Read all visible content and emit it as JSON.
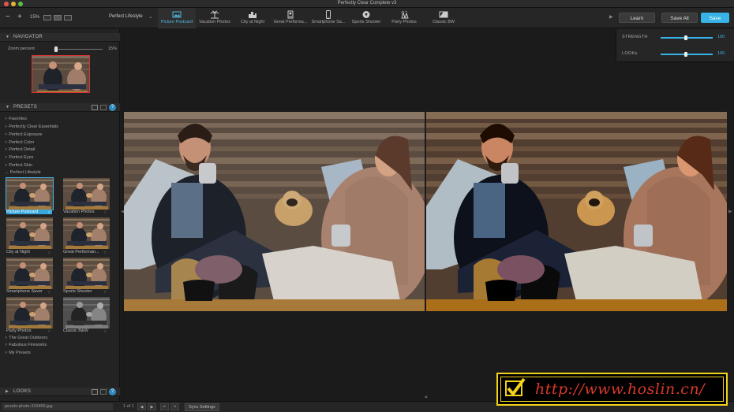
{
  "window": {
    "title": "Perfectly Clear Complete v3"
  },
  "toolbar": {
    "zoom_out": "−",
    "zoom_in": "+",
    "zoom_percent": "15%",
    "preset_selector": "Perfect Lifestyle",
    "preset_tabs": [
      {
        "label": "Picture Postcard",
        "icon": "postcard-icon",
        "active": true
      },
      {
        "label": "Vacation Photos",
        "icon": "palm-tree-icon",
        "active": false
      },
      {
        "label": "City at Night",
        "icon": "city-icon",
        "active": false
      },
      {
        "label": "Great Performa...",
        "icon": "performance-icon",
        "active": false
      },
      {
        "label": "Smartphone Sa...",
        "icon": "smartphone-icon",
        "active": false
      },
      {
        "label": "Sports Shooter",
        "icon": "soccer-ball-icon",
        "active": false
      },
      {
        "label": "Party Photos",
        "icon": "party-icon",
        "active": false
      },
      {
        "label": "Classic BW",
        "icon": "classic-bw-icon",
        "active": false
      }
    ],
    "learn_label": "Learn",
    "save_all_label": "Save All",
    "save_label": "Save"
  },
  "navigator": {
    "title": "NAVIGATOR",
    "zoom_label": "Zoom percent",
    "zoom_value": 0.03,
    "zoom_value_label": "15%"
  },
  "presets": {
    "title": "PRESETS",
    "categories_before": [
      "Favorites",
      "Perfectly Clear Essentials",
      "Perfect Exposure",
      "Perfect Color",
      "Perfect Detail",
      "Perfect Eyes",
      "Perfect Skin",
      "Perfect Lifestyle"
    ],
    "thumbnails": [
      {
        "label": "Picture Postcard",
        "selected": true
      },
      {
        "label": "Vacation Photos",
        "selected": false
      },
      {
        "label": "City at Night",
        "selected": false
      },
      {
        "label": "Great Performan...",
        "selected": false
      },
      {
        "label": "Smartphone Saver",
        "selected": false
      },
      {
        "label": "Sports Shooter",
        "selected": false
      },
      {
        "label": "Party Photos",
        "selected": false
      },
      {
        "label": "Classic B&W",
        "selected": false
      }
    ],
    "categories_after": [
      "The Great Outdoors",
      "Fabulous Fireworks",
      "My Presets"
    ]
  },
  "looks": {
    "title": "LOOKS"
  },
  "adjustments": {
    "strength_label": "STRENGTH",
    "strength_value": "100",
    "strength_level": 0.5,
    "looks_label": "LOOKs",
    "looks_value": "100",
    "looks_level": 0.5
  },
  "statusbar": {
    "filename": "pexels-photo-316465.jpg",
    "page_indicator": "1 of 1",
    "sync_label": "Sync Settings"
  },
  "watermark": {
    "text": "http://www.hoslin.cn/"
  },
  "colors": {
    "accent": "#37b3e8",
    "panel": "#232323",
    "canvas": "#1b1b1b"
  }
}
